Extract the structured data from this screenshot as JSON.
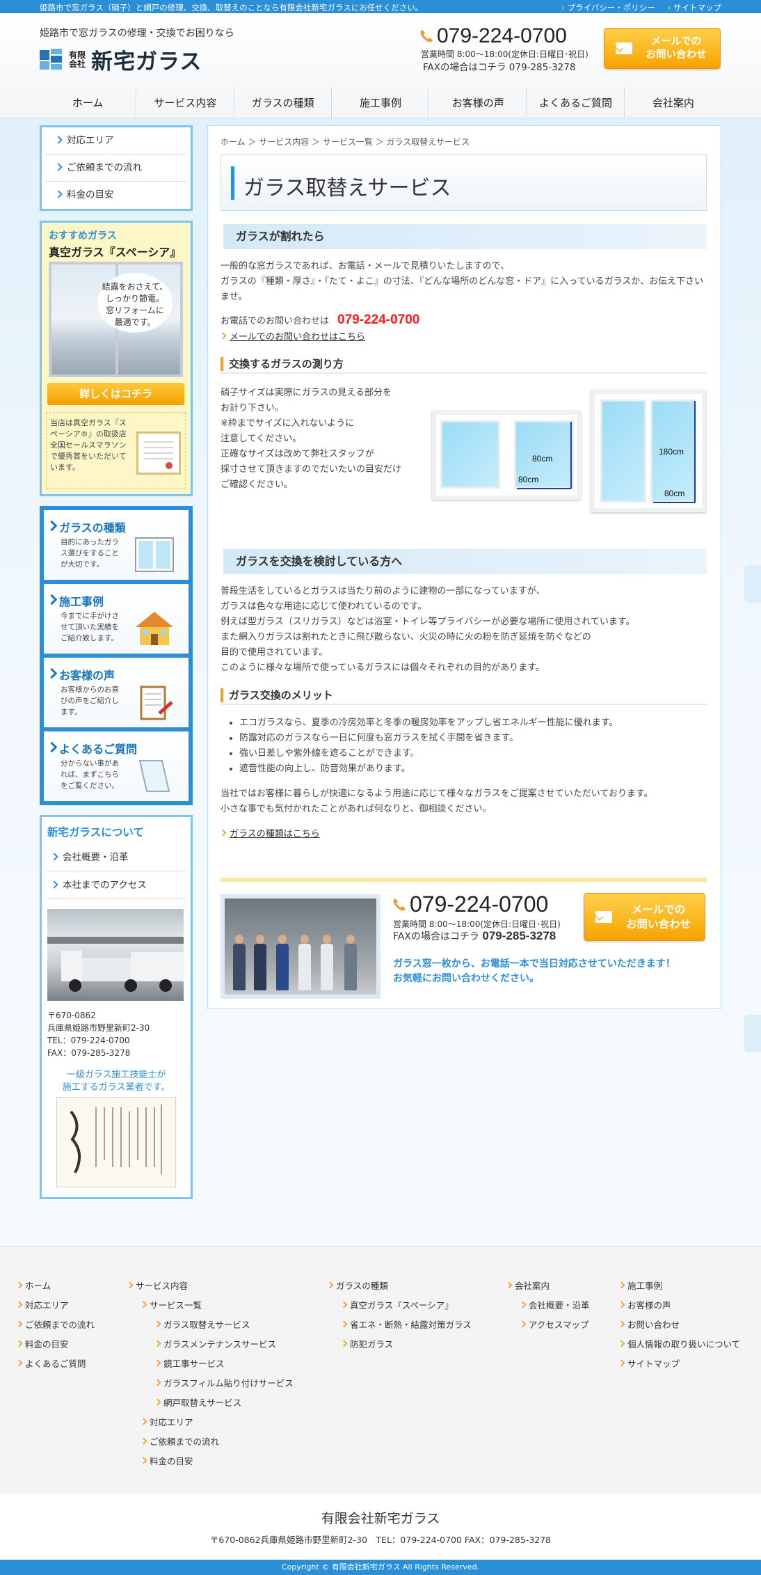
{
  "topbar": {
    "tagline": "姫路市で窓ガラス（硝子）と網戸の修理、交換、取替えのことなら有限会社新宅ガラスにお任せください。",
    "privacy": "プライバシー・ポリシー",
    "sitemap": "サイトマップ"
  },
  "header": {
    "catch": "姫路市で窓ガラスの修理・交換でお困りなら",
    "logo_co1": "有限",
    "logo_co2": "会社",
    "logo_name": "新宅ガラス",
    "phone": "079-224-0700",
    "hours": "営業時間 8:00～18:00(定休日:日曜日･祝日)",
    "fax": "FAXの場合はコチラ 079-285-3278",
    "mail_line1": "メールでの",
    "mail_line2": "お問い合わせ"
  },
  "gnav": [
    "ホーム",
    "サービス内容",
    "ガラスの種類",
    "施工事例",
    "お客様の声",
    "よくあるご質問",
    "会社案内"
  ],
  "sidebar": {
    "menu": [
      "対応エリア",
      "ご依頼までの流れ",
      "料金の目安"
    ],
    "rec": {
      "label": "おすすめガラス",
      "title": "真空ガラス『スペーシア』",
      "bubble1": "結露をおさえて、",
      "bubble2": "しっかり節電。",
      "bubble3": "窓リフォームに",
      "bubble4": "最適です。",
      "more": "詳しくはコチラ",
      "note": "当店は真空ガラス『スペーシア®』の取扱店 全国セールスマラソンで優秀賞をいただいています。"
    },
    "big": [
      {
        "title": "ガラスの種類",
        "desc": "目的にあったガラス選びをすることが大切です。"
      },
      {
        "title": "施工事例",
        "desc": "今までに手がけさせて頂いた実績をご紹介致します。"
      },
      {
        "title": "お客様の声",
        "desc": "お客様からのお喜びの声をご紹介します。"
      },
      {
        "title": "よくあるご質問",
        "desc": "分からない事があれば、まずこちらをご覧ください。"
      }
    ],
    "about": {
      "title": "新宅ガラスについて",
      "links": [
        "会社概要・沿革",
        "本社までのアクセス"
      ],
      "zip": "〒670-0862",
      "addr": "兵庫県姫路市野里新町2-30",
      "tel": "TEL：079-224-0700",
      "fax": "FAX：079-285-3278",
      "cap1": "一級ガラス施工技能士が",
      "cap2": "施工するガラス業者です。"
    }
  },
  "main": {
    "breadcrumb": "ホーム ＞ サービス内容 ＞ サービス一覧 ＞ ガラス取替えサービス",
    "title": "ガラス取替えサービス",
    "sec1": {
      "heading": "ガラスが割れたら",
      "p1": "一般的な窓ガラスであれば、お電話・メールで見積りいたしますので、",
      "p2": "ガラスの『種類・厚さ』・『たて・よこ』の寸法、『どんな場所のどんな窓・ドア』に入っているガラスか、お伝え下さいませ。",
      "tel_label": "お電話でのお問い合わせは",
      "tel": "079-224-0700",
      "mail_link": "メールでのお問い合わせはこちら"
    },
    "measure": {
      "heading": "交換するガラスの測り方",
      "lines": [
        "硝子サイズは実際にガラスの見える部分を",
        "お計り下さい。",
        "※枠までサイズに入れないように",
        "注意してください。",
        "正確なサイズは改めて弊社スタッフが",
        "採寸させて頂きますのでだいたいの目安だけ",
        "ご確認ください。"
      ],
      "dim_h1": "80cm",
      "dim_w1": "80cm",
      "dim_h2": "180cm",
      "dim_w2": "80cm"
    },
    "sec2": {
      "heading": "ガラスを交換を検討している方へ",
      "lines": [
        "普段生活をしているとガラスは当たり前のように建物の一部になっていますが、",
        "ガラスは色々な用途に応じて使われているのです。",
        "例えば型ガラス（スリガラス）などは浴室・トイレ等プライバシーが必要な場所に使用されています。",
        "また網入りガラスは割れたときに飛び散らない、火災の時に火の粉を防ぎ延焼を防ぐなどの",
        "目的で使用されています。",
        "このように様々な場所で使っているガラスには個々それぞれの目的があります。"
      ]
    },
    "merit": {
      "heading": "ガラス交換のメリット",
      "items": [
        "エコガラスなら、夏季の冷房効率と冬季の暖房効率をアップし省エネルギー性能に優れます。",
        "防露対応のガラスなら一日に何度も窓ガラスを拭く手間を省きます。",
        "強い日差しや紫外線を遮ることができます。",
        "遮音性能の向上し、防音効果があります。"
      ],
      "p1": "当社ではお客様に暮らしが快適になるよう用途に応じて様々なガラスをご提案させていただいております。",
      "p2": "小さな事でも気付かれたことがあれば何なりと、御相談ください。",
      "link": "ガラスの種類はこちら"
    },
    "cta": {
      "phone": "079-224-0700",
      "hours": "営業時間 8:00～18:00(定休日:日曜日･祝日)",
      "fax_label": "FAXの場合はコチラ",
      "fax": "079-285-3278",
      "mail_line1": "メールでの",
      "mail_line2": "お問い合わせ",
      "msg1": "ガラス窓一枚から、お電話一本で当日対応させていただきます！",
      "msg2": "お気軽にお問い合わせください。"
    }
  },
  "footer_nav": {
    "c1": [
      "ホーム",
      "対応エリア",
      "ご依頼までの流れ",
      "料金の目安",
      "よくあるご質問"
    ],
    "c2_top": "サービス内容",
    "c2_sub": "サービス一覧",
    "c2_items": [
      "ガラス取替えサービス",
      "ガラスメンテナンスサービス",
      "鏡工事サービス",
      "ガラスフィルム貼り付けサービス",
      "網戸取替えサービス"
    ],
    "c2_after": [
      "対応エリア",
      "ご依頼までの流れ",
      "料金の目安"
    ],
    "c3_top": "ガラスの種類",
    "c3_items": [
      "真空ガラス『スペーシア』",
      "省エネ・断熱・結露対策ガラス",
      "防犯ガラス"
    ],
    "c4_top": "会社案内",
    "c4_items": [
      "会社概要・沿革",
      "アクセスマップ"
    ],
    "c5": [
      "施工事例",
      "お客様の声",
      "お問い合わせ",
      "個人情報の取り扱いについて",
      "サイトマップ"
    ]
  },
  "footer": {
    "name": "有限会社新宅ガラス",
    "addr": "〒670-0862兵庫県姫路市野里新町2-30　TEL：079-224-0700 FAX：079-285-3278",
    "copy": "Copyright © 有限会社新宅ガラス All Rights Reserved."
  },
  "colors": {
    "accent": "#2b8fd8",
    "orange": "#f7a300",
    "tel_red": "#ff1a1a"
  }
}
